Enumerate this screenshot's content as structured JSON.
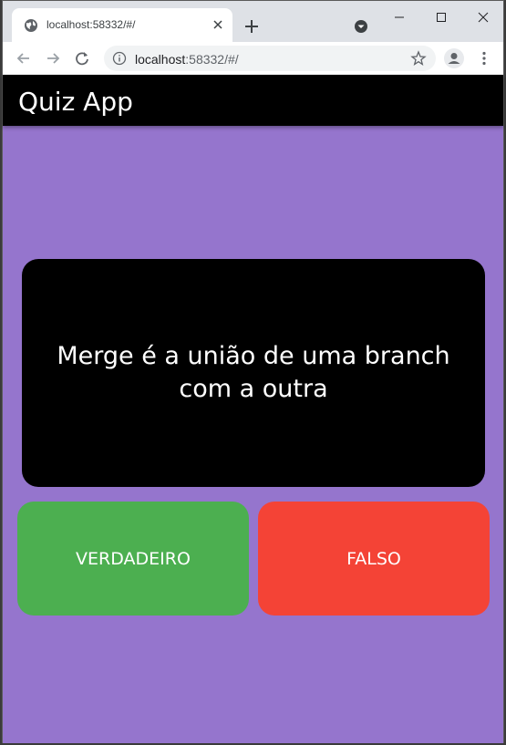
{
  "browser": {
    "tab": {
      "title": "localhost:58332/#/",
      "favicon": "globe-icon"
    },
    "address_bar": {
      "host": "localhost",
      "rest": ":58332/#/"
    }
  },
  "app": {
    "title": "Quiz App",
    "background_color": "#9575cd",
    "question": "Merge é a união de uma branch com a outra",
    "buttons": {
      "true_label": "VERDADEIRO",
      "true_color": "#4caf50",
      "false_label": "FALSO",
      "false_color": "#f44336"
    }
  }
}
